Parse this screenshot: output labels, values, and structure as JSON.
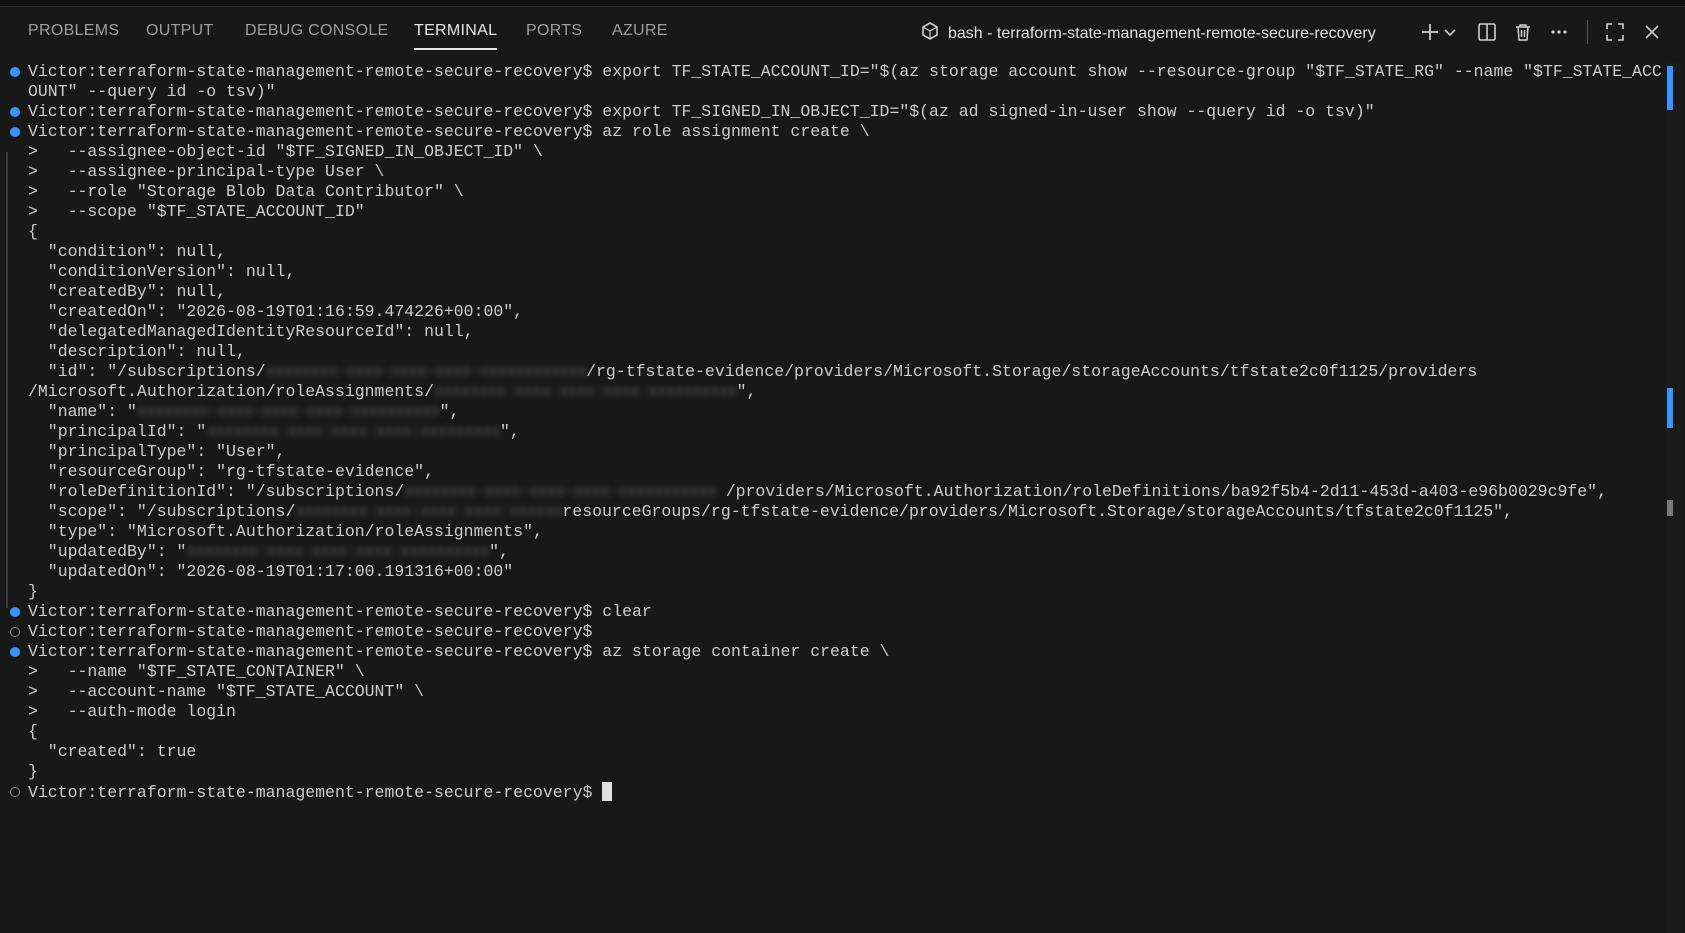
{
  "panel": {
    "tabs": [
      {
        "label": "PROBLEMS"
      },
      {
        "label": "OUTPUT"
      },
      {
        "label": "DEBUG CONSOLE"
      },
      {
        "label": "TERMINAL"
      },
      {
        "label": "PORTS"
      },
      {
        "label": "AZURE"
      }
    ],
    "active_tab": "TERMINAL",
    "terminal_title": "bash - terraform-state-management-remote-secure-recovery",
    "icons": [
      "terminal-shell-icon",
      "add-icon",
      "chevron-down-icon",
      "split-icon",
      "trash-icon",
      "more-icon",
      "maximize-icon",
      "close-icon"
    ]
  },
  "terminal": {
    "prompt": "Victor:terraform-state-management-remote-secure-recovery$",
    "lines": [
      {
        "mark": "blue",
        "text": "Victor:terraform-state-management-remote-secure-recovery$ export TF_STATE_ACCOUNT_ID=\"$(az storage account show --resource-group \"$TF_STATE_RG\" --name \"$TF_STATE_ACC"
      },
      {
        "mark": "",
        "text": "OUNT\" --query id -o tsv)\""
      },
      {
        "mark": "blue",
        "text": "Victor:terraform-state-management-remote-secure-recovery$ export TF_SIGNED_IN_OBJECT_ID=\"$(az ad signed-in-user show --query id -o tsv)\""
      },
      {
        "mark": "blue",
        "text": "Victor:terraform-state-management-remote-secure-recovery$ az role assignment create \\"
      },
      {
        "mark": "",
        "text": ">   --assignee-object-id \"$TF_SIGNED_IN_OBJECT_ID\" \\"
      },
      {
        "mark": "",
        "text": ">   --assignee-principal-type User \\"
      },
      {
        "mark": "",
        "text": ">   --role \"Storage Blob Data Contributor\" \\"
      },
      {
        "mark": "",
        "text": ">   --scope \"$TF_STATE_ACCOUNT_ID\""
      },
      {
        "mark": "",
        "text": "{"
      },
      {
        "mark": "",
        "text": "  \"condition\": null,"
      },
      {
        "mark": "",
        "text": "  \"conditionVersion\": null,"
      },
      {
        "mark": "",
        "text": "  \"createdBy\": null,"
      },
      {
        "mark": "",
        "text": "  \"createdOn\": \"2026-08-19T01:16:59.474226+00:00\","
      },
      {
        "mark": "",
        "text": "  \"delegatedManagedIdentityResourceId\": null,"
      },
      {
        "mark": "",
        "text": "  \"description\": null,"
      },
      {
        "mark": "",
        "text": "  \"id\": \"/subscriptions/",
        "blur": "xxxxxxxx-xxxx-xxxx-xxxx-xxxxxxxxxxxx",
        "after": "/rg-tfstate-evidence/providers/Microsoft.Storage/storageAccounts/tfstate2c0f1125/providers"
      },
      {
        "mark": "",
        "text": "/Microsoft.Authorization/roleAssignments/",
        "blur": "xxxxxxxx-xxxx-xxxx-xxxx-xxxxxxxxxx",
        "after": "\","
      },
      {
        "mark": "",
        "text": "  \"name\": \"",
        "blur": "xxxxxxxx-xxxx-xxxx-xxxx-xxxxxxxxxx",
        "after": "\","
      },
      {
        "mark": "",
        "text": "  \"principalId\": \"",
        "blur": "xxxxxxxx-xxxx-xxxx-xxxx-xxxxxxxxx",
        "after": "\","
      },
      {
        "mark": "",
        "text": "  \"principalType\": \"User\","
      },
      {
        "mark": "",
        "text": "  \"resourceGroup\": \"rg-tfstate-evidence\","
      },
      {
        "mark": "",
        "text": "  \"roleDefinitionId\": \"/subscriptions/",
        "blur": "xxxxxxxx-xxxx-xxxx-xxxx-xxxxxxxxxxx",
        "after": " /providers/Microsoft.Authorization/roleDefinitions/ba92f5b4-2d11-453d-a403-e96b0029c9fe\","
      },
      {
        "mark": "",
        "text": "  \"scope\": \"/subscriptions/",
        "blur": "xxxxxxxx-xxxx-xxxx-xxxx-xxxxxx",
        "after": "resourceGroups/rg-tfstate-evidence/providers/Microsoft.Storage/storageAccounts/tfstate2c0f1125\","
      },
      {
        "mark": "",
        "text": "  \"type\": \"Microsoft.Authorization/roleAssignments\","
      },
      {
        "mark": "",
        "text": "  \"updatedBy\": \"",
        "blur": "xxxxxxxx-xxxx-xxxx-xxxx-xxxxxxxxxx",
        "after": "\","
      },
      {
        "mark": "",
        "text": "  \"updatedOn\": \"2026-08-19T01:17:00.191316+00:00\""
      },
      {
        "mark": "",
        "text": "}"
      },
      {
        "mark": "blue",
        "text": "Victor:terraform-state-management-remote-secure-recovery$ clear"
      },
      {
        "mark": "hollow",
        "text": "Victor:terraform-state-management-remote-secure-recovery$"
      },
      {
        "mark": "blue",
        "text": "Victor:terraform-state-management-remote-secure-recovery$ az storage container create \\"
      },
      {
        "mark": "",
        "text": ">   --name \"$TF_STATE_CONTAINER\" \\"
      },
      {
        "mark": "",
        "text": ">   --account-name \"$TF_STATE_ACCOUNT\" \\"
      },
      {
        "mark": "",
        "text": ">   --auth-mode login"
      },
      {
        "mark": "",
        "text": "{"
      },
      {
        "mark": "",
        "text": "  \"created\": true"
      },
      {
        "mark": "",
        "text": "}"
      },
      {
        "mark": "hollow",
        "text": "Victor:terraform-state-management-remote-secure-recovery$ ",
        "cursor": true
      }
    ]
  }
}
